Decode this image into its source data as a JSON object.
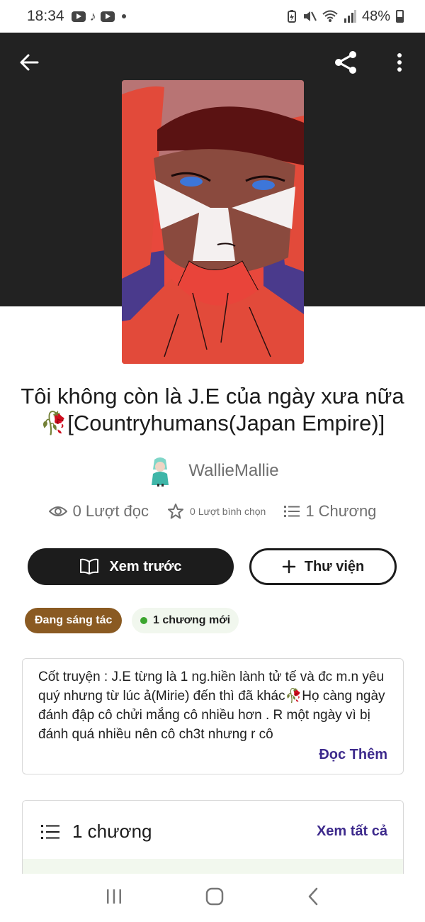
{
  "status_bar": {
    "time": "18:34",
    "battery": "48%",
    "left_icons": [
      "youtube-icon",
      "tiktok-icon",
      "youtube-icon"
    ],
    "right_icons": [
      "battery-saver-icon",
      "mute-icon",
      "wifi-icon",
      "signal-icon",
      "battery-icon"
    ]
  },
  "story": {
    "title": "Tôi không còn là J.E của ngày xưa nữa🥀[Countryhumans(Japan Empire)]",
    "author": "WallieMallie",
    "reads": "0 Lượt đọc",
    "votes": "0 Lượt bình chọn",
    "parts": "1 Chương"
  },
  "actions": {
    "preview_label": "Xem trước",
    "library_label": "Thư viện"
  },
  "badges": {
    "status": "Đang sáng tác",
    "new_chapters": "1 chương mới"
  },
  "synopsis": {
    "text": "Cốt truyện : J.E từng là 1 ng.hiền lành tử tế và đc m.n yêu quý nhưng từ lúc ả(Mirie) đến thì đã khác🥀Họ càng ngày đánh đập cô chửi mắng cô nhiều hơn . R một ngày vì bị đánh quá nhiều nên cô ch3t nhưng r cô",
    "read_more": "Đọc Thêm"
  },
  "chapters": {
    "count_label": "1 chương",
    "view_all": "Xem tất cả"
  },
  "colors": {
    "header_bg": "#222222",
    "accent_link": "#3d2a8c",
    "status_badge": "#8a5a22",
    "new_dot": "#3ca52f"
  }
}
